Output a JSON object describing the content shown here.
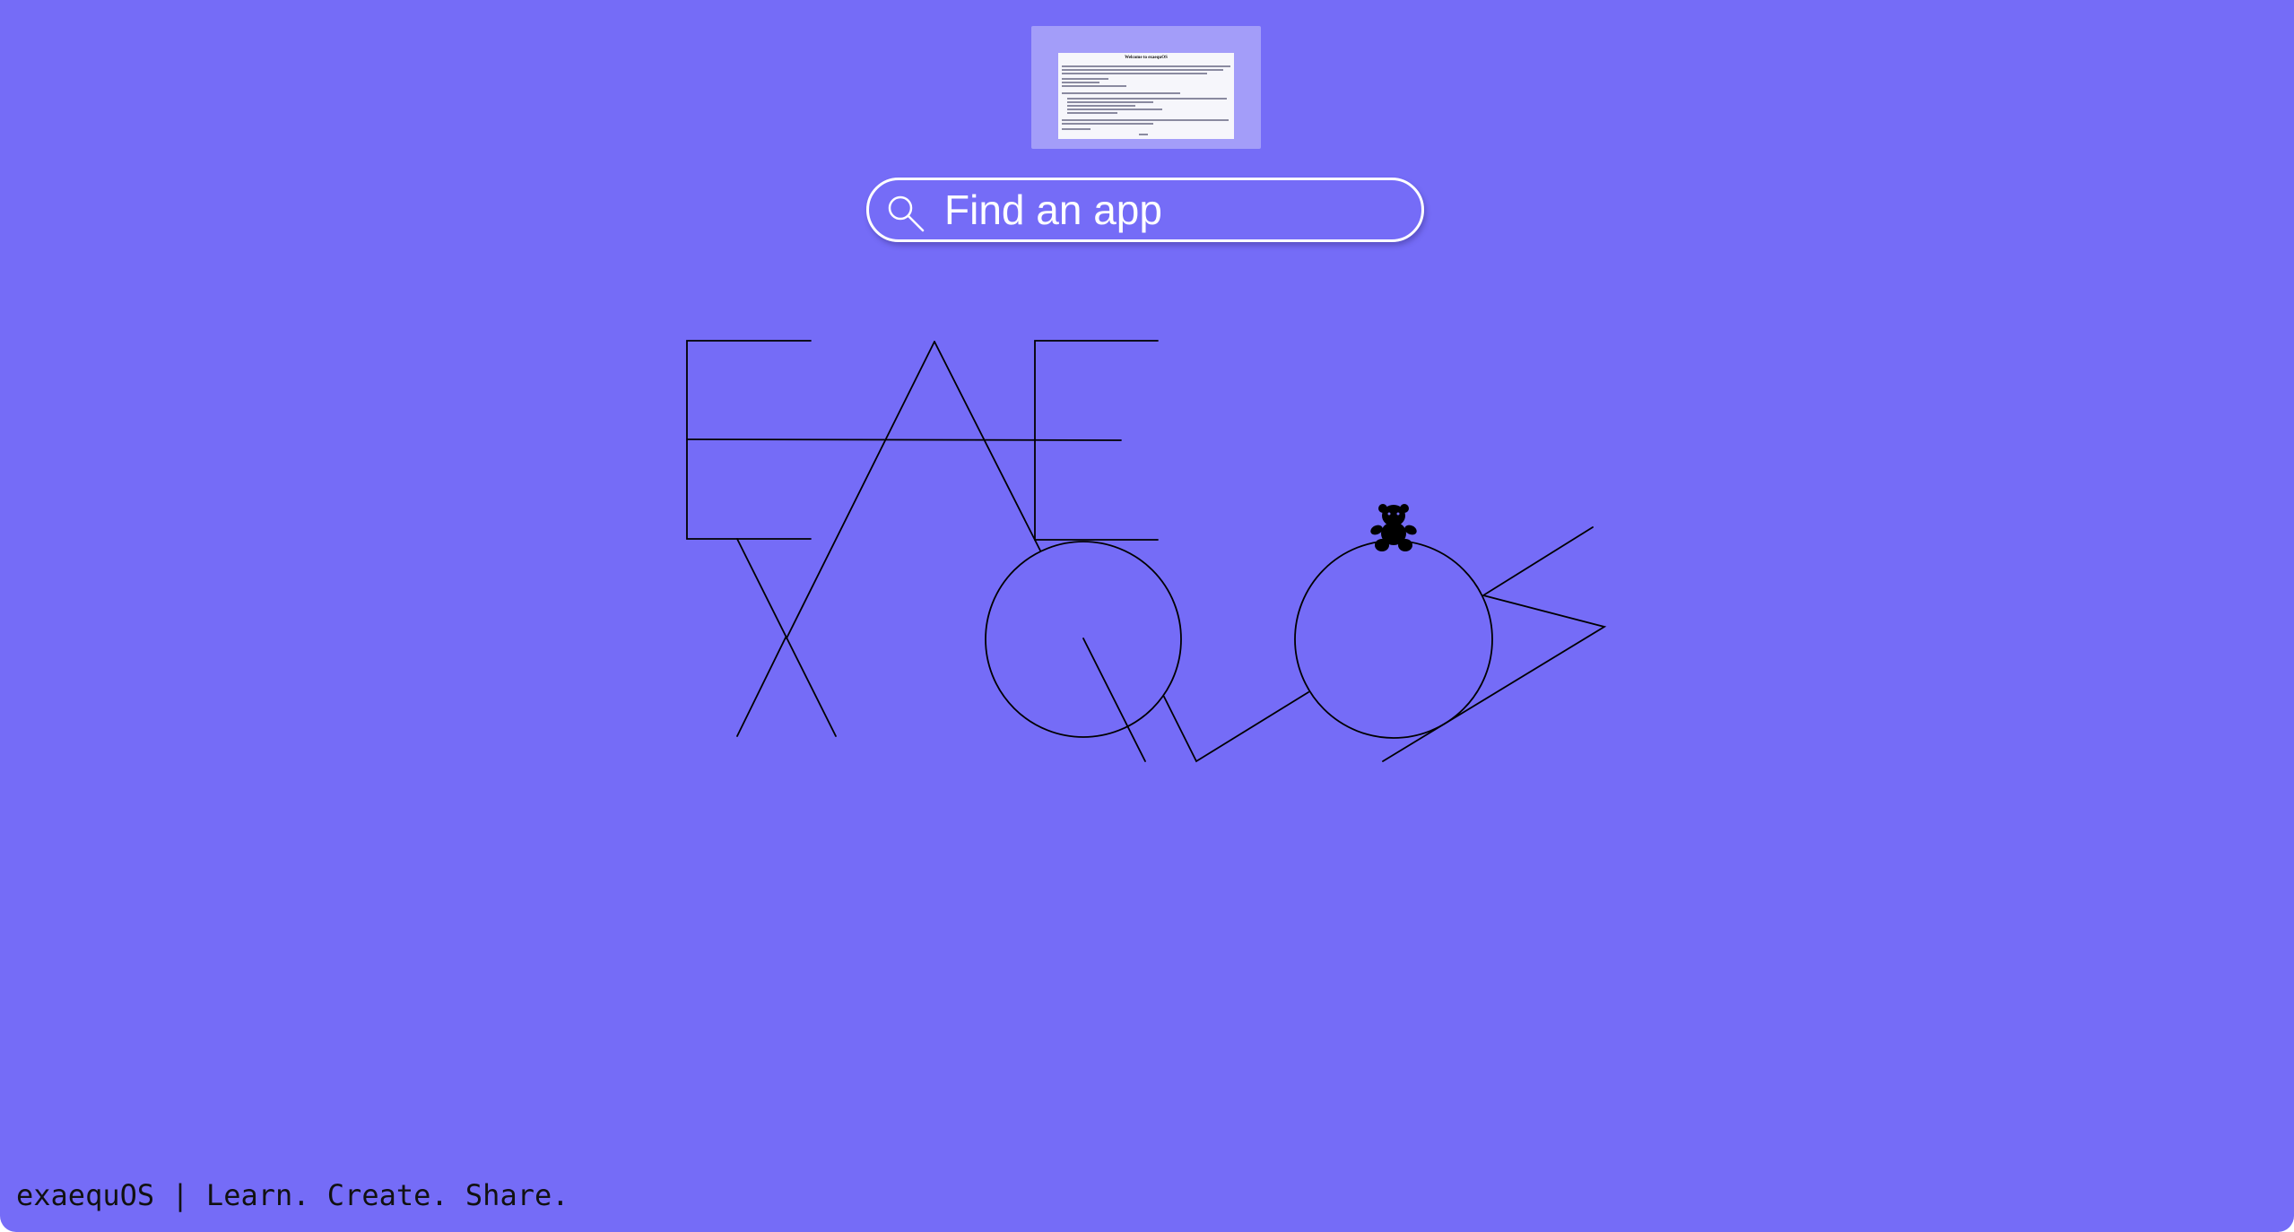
{
  "desktop": {
    "background_color": "#756cf7",
    "window_thumbnail": {
      "title": "Welcome to exaequOS"
    },
    "search": {
      "placeholder": "Find an app",
      "icon": "search-icon"
    },
    "logo": {
      "name": "exaequOS",
      "mascot_icon": "teddy-bear-icon"
    },
    "footer": {
      "text": "exaequOS | Learn. Create. Share."
    }
  }
}
